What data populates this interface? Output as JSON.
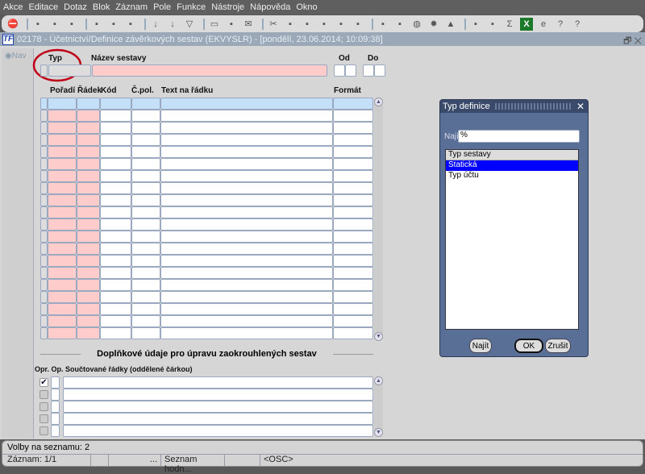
{
  "menu": [
    "Akce",
    "Editace",
    "Dotaz",
    "Blok",
    "Záznam",
    "Pole",
    "Funkce",
    "Nástroje",
    "Nápověda",
    "Okno"
  ],
  "toolbar_icons": [
    "exit-icon",
    "sep",
    "new-record-icon",
    "save-icon",
    "delete-record-icon",
    "sep",
    "copy-icon",
    "paste-icon",
    "clear-icon",
    "sep",
    "sort-asc-icon",
    "sort-desc-icon",
    "filter-icon",
    "sep",
    "print-icon",
    "print-preview-icon",
    "mail-icon",
    "sep",
    "cut-icon",
    "translate-icon",
    "replace-icon",
    "find-icon",
    "outline-icon",
    "tree-icon",
    "sep",
    "export-icon",
    "report-icon",
    "globe-icon",
    "wheel-icon",
    "eye-icon",
    "sep",
    "chart-icon",
    "disk-icon",
    "sum-icon",
    "excel-icon",
    "ie-icon",
    "help-lock-icon",
    "help-icon"
  ],
  "window": {
    "logo": "TF",
    "title": "02178 - Účetnictví/Definice závěrkových sestav (EKVYSLR) - [pondělí, 23.06.2014; 10:09:38]"
  },
  "nav": {
    "label": "Nav"
  },
  "header": {
    "typ": "Typ",
    "nazev": "Název sestavy",
    "od": "Od",
    "do": "Do"
  },
  "grid": {
    "columns": [
      "Pořadí",
      "Řádek",
      "Kód",
      "Č.pol.",
      "Text na řádku",
      "Formát"
    ],
    "row_count": 20
  },
  "section": {
    "title": "Doplňkové údaje pro úpravu zaokrouhlených sestav",
    "headers": "Opr. Op. Součtované řádky (oddělené čárkou)",
    "rows": [
      {
        "checked": true
      },
      {
        "checked": false
      },
      {
        "checked": false
      },
      {
        "checked": false
      },
      {
        "checked": false
      }
    ]
  },
  "dialog": {
    "title": "Typ definice",
    "find_label": "Najít",
    "find_value": "%",
    "list_header": "Typ sestavy",
    "items": [
      "Statická",
      "Typ účtu"
    ],
    "selected": 0,
    "buttons": {
      "find": "Najít",
      "ok": "OK",
      "cancel": "Zrušit"
    }
  },
  "status": {
    "line1": "Volby na seznamu: 2",
    "record": "Záznam: 1/1",
    "ellipsis": "...",
    "list": "Seznam hodn...",
    "mode": "<OSC>"
  }
}
